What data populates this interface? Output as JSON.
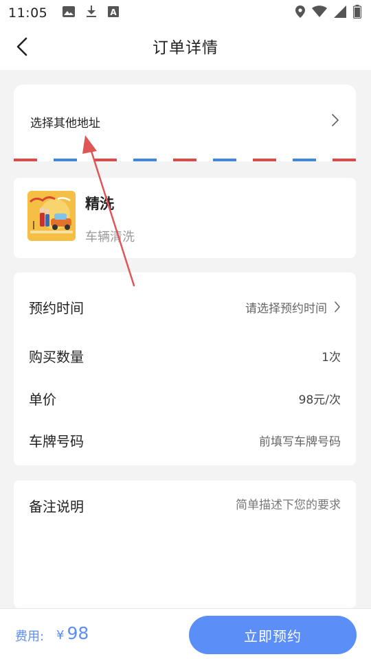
{
  "status_bar": {
    "time": "11:05",
    "left_icons": [
      "image-icon",
      "download-icon",
      "font-icon"
    ],
    "right_icons": [
      "location-icon",
      "wifi-icon",
      "signal-icon",
      "battery-icon"
    ]
  },
  "header": {
    "title": "订单详情",
    "back_icon": "chevron-left-icon"
  },
  "address": {
    "label": "选择其他地址",
    "chevron_icon": "chevron-right-icon",
    "stripe_colors": [
      "#e04848",
      "#3e86e0"
    ]
  },
  "service": {
    "name": "精洗",
    "description": "车辆清洗"
  },
  "details": [
    {
      "label": "预约时间",
      "value": "请选择预约时间"
    },
    {
      "label": "购买数量",
      "value": "1次"
    },
    {
      "label": "单价",
      "value": "98元/次"
    },
    {
      "label": "车牌号码",
      "value": "前填写车牌号码"
    }
  ],
  "remarks": {
    "label": "备注说明",
    "placeholder": "简单描述下您的要求"
  },
  "footer": {
    "fee_label": "费用:",
    "currency": "¥",
    "fee_value": "98",
    "book_button": "立即预约"
  },
  "colors": {
    "accent": "#5b8ef6",
    "annotation_arrow": "#e05555"
  }
}
